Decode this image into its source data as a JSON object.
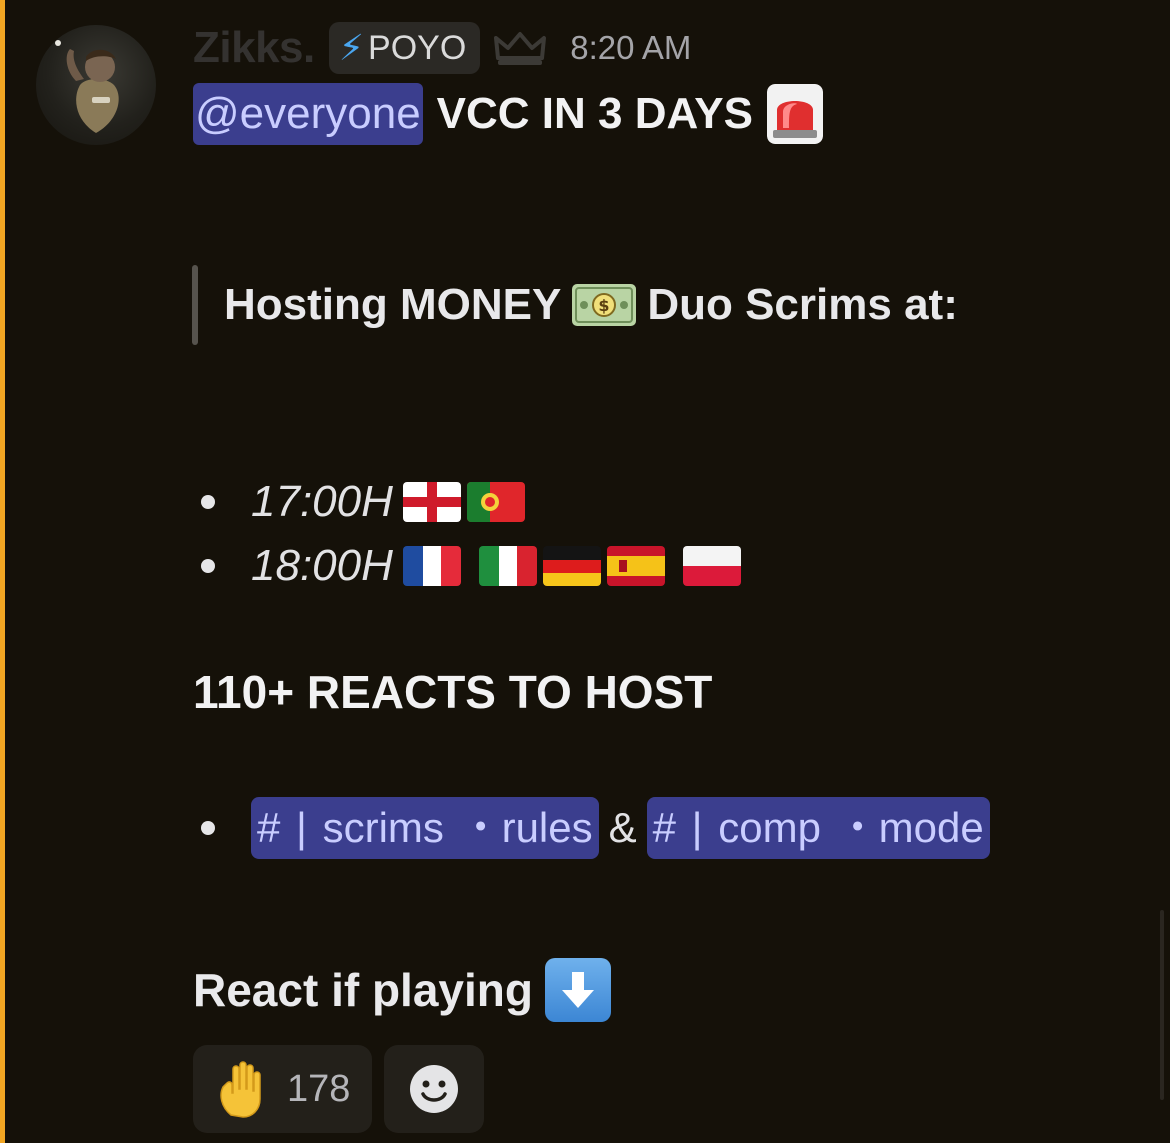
{
  "message": {
    "author": "Zikks.",
    "tag": "POYO",
    "timestamp": "8:20 AM",
    "mention": "@everyone",
    "headline": "VCC IN 3 DAYS",
    "quote_prefix": "Hosting MONEY",
    "quote_suffix": "Duo Scrims at:",
    "schedule": [
      {
        "time": "17:00H",
        "flags": [
          "england",
          "portugal"
        ]
      },
      {
        "time": "18:00H",
        "flags": [
          "france",
          "italy",
          "germany",
          "spain",
          "poland"
        ]
      }
    ],
    "requirement": "110+ REACTS TO HOST",
    "channels": [
      {
        "label": "#  |  scrims ・rules"
      },
      {
        "label": "#  |  comp ・mode"
      }
    ],
    "channel_joiner": "&",
    "call_to_action": "React if playing"
  },
  "reactions": [
    {
      "emoji": "raised-hand",
      "count": "178"
    }
  ],
  "icons": {
    "tag_icon": "lightning-icon",
    "role_icon": "crown-icon",
    "headline_emoji": "siren-icon",
    "quote_emoji": "money-bill-icon",
    "cta_emoji": "down-arrow-icon",
    "add_reaction": "smiley-icon"
  },
  "colors": {
    "mention_bg": "#3b3e8e",
    "mention_text": "#c9cdff",
    "highlight_bar": "#f2a623",
    "background": "#151109"
  }
}
